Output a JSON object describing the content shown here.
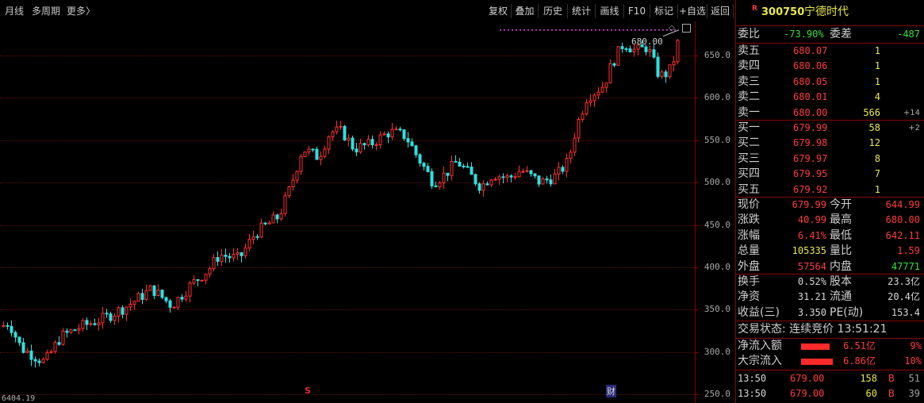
{
  "toolbar": {
    "period": "月线",
    "multi_period": "多周期",
    "more": "更多",
    "more_arrow": "〉",
    "buttons": [
      "复权",
      "叠加",
      "历史",
      "统计",
      "画线",
      "F10",
      "标记",
      "+自选",
      "返回"
    ]
  },
  "chart": {
    "max_label": "680.00",
    "marker_s": "S",
    "marker_cai": "财",
    "bottom_number": "6404.19",
    "up_color": "#ff3030",
    "down_color": "#30e0e0"
  },
  "chart_data": {
    "type": "candlestick",
    "ylim": [
      240,
      690
    ],
    "yticks": [
      "650.0",
      "600.0",
      "550.0",
      "500.0",
      "450.0",
      "400.0",
      "350.0",
      "300.0",
      "250.0"
    ]
  },
  "quote": {
    "r_badge": "R",
    "code": "300750",
    "name": "宁德时代",
    "wei_bi_label": "委比",
    "wei_bi": "-73.90%",
    "wei_cha_label": "委差",
    "wei_cha": "-487",
    "asks": [
      {
        "label": "卖五",
        "price": "680.07",
        "vol": "1",
        "delta": ""
      },
      {
        "label": "卖四",
        "price": "680.06",
        "vol": "1",
        "delta": ""
      },
      {
        "label": "卖三",
        "price": "680.05",
        "vol": "1",
        "delta": ""
      },
      {
        "label": "卖二",
        "price": "680.01",
        "vol": "4",
        "delta": ""
      },
      {
        "label": "卖一",
        "price": "680.00",
        "vol": "566",
        "delta": "+14"
      }
    ],
    "bids": [
      {
        "label": "买一",
        "price": "679.99",
        "vol": "58",
        "delta": "+2"
      },
      {
        "label": "买二",
        "price": "679.98",
        "vol": "12",
        "delta": ""
      },
      {
        "label": "买三",
        "price": "679.97",
        "vol": "8",
        "delta": ""
      },
      {
        "label": "买四",
        "price": "679.95",
        "vol": "7",
        "delta": ""
      },
      {
        "label": "买五",
        "price": "679.92",
        "vol": "1",
        "delta": ""
      }
    ],
    "stats": [
      {
        "l1": "现价",
        "v1": "679.99",
        "l2": "今开",
        "v2": "644.99"
      },
      {
        "l1": "涨跌",
        "v1": "40.99",
        "l2": "最高",
        "v2": "680.00"
      },
      {
        "l1": "涨幅",
        "v1": "6.41%",
        "l2": "最低",
        "v2": "642.11"
      },
      {
        "l1": "总量",
        "v1": "105335",
        "l2": "量比",
        "v2": "1.59"
      },
      {
        "l1": "外盘",
        "v1": "57564",
        "l2": "内盘",
        "v2": "47771"
      }
    ],
    "stats2": [
      {
        "l1": "换手",
        "v1": "0.52%",
        "l2": "股本",
        "v2": "23.3亿"
      },
      {
        "l1": "净资",
        "v1": "31.21",
        "l2": "流通",
        "v2": "20.4亿"
      },
      {
        "l1": "收益(三)",
        "v1": "3.350",
        "l2": "PE(动)",
        "v2": "153.4"
      }
    ],
    "trade_status": "交易状态: 连续竞价 13:51:21",
    "flows": [
      {
        "label": "净流入额",
        "value": "6.51亿",
        "pct": "9%",
        "fill": 0.9
      },
      {
        "label": "大宗流入",
        "value": "6.86亿",
        "pct": "10%",
        "fill": 1.0
      }
    ],
    "ticks": [
      {
        "time": "13:50",
        "price": "679.00",
        "vol": "158",
        "side": "B",
        "count": "51"
      },
      {
        "time": "13:50",
        "price": "679.00",
        "vol": "60",
        "side": "B",
        "count": "39"
      }
    ]
  }
}
